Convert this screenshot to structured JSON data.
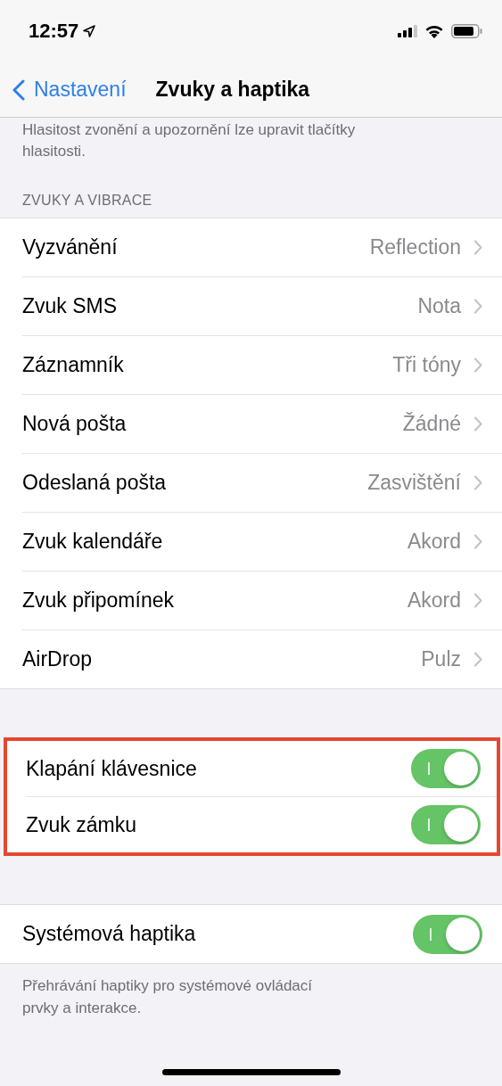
{
  "status_bar": {
    "time": "12:57",
    "location_active": true
  },
  "nav": {
    "back_label": "Nastavení",
    "title": "Zvuky a haptika"
  },
  "volume_note": "Hlasitost zvonění a upozornění lze upravit tlačítky hlasitosti.",
  "sections": [
    {
      "header": "ZVUKY A VIBRACE",
      "highlighted": false,
      "rows": [
        {
          "kind": "link",
          "label": "Vyzvánění",
          "value": "Reflection"
        },
        {
          "kind": "link",
          "label": "Zvuk SMS",
          "value": "Nota"
        },
        {
          "kind": "link",
          "label": "Záznamník",
          "value": "Tři tóny"
        },
        {
          "kind": "link",
          "label": "Nová pošta",
          "value": "Žádné"
        },
        {
          "kind": "link",
          "label": "Odeslaná pošta",
          "value": "Zasvištění"
        },
        {
          "kind": "link",
          "label": "Zvuk kalendáře",
          "value": "Akord"
        },
        {
          "kind": "link",
          "label": "Zvuk připomínek",
          "value": "Akord"
        },
        {
          "kind": "link",
          "label": "AirDrop",
          "value": "Pulz"
        }
      ]
    },
    {
      "highlighted": true,
      "rows": [
        {
          "kind": "toggle",
          "label": "Klapání klávesnice",
          "on": true
        },
        {
          "kind": "toggle",
          "label": "Zvuk zámku",
          "on": true
        }
      ]
    },
    {
      "highlighted": false,
      "rows": [
        {
          "kind": "toggle",
          "label": "Systémová haptika",
          "on": true
        }
      ],
      "footer": "Přehrávání haptiky pro systémové ovládací prvky a interakce."
    }
  ]
}
